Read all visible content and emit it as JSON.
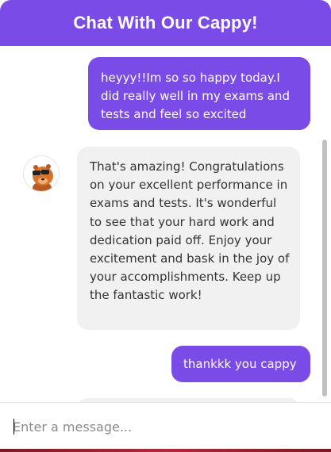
{
  "header": {
    "title": "Chat With Our Cappy!"
  },
  "messages": [
    {
      "sender": "user",
      "text": "heyyy!!Im so so happy today.I did really well in my exams and tests and feel so excited"
    },
    {
      "sender": "bot",
      "text": "That's amazing! Congratulations on your excellent performance in exams and tests. It's wonderful to see that your hard work and dedication paid off. Enjoy your excitement and bask in the joy of your accomplishments. Keep up the fantastic work!"
    },
    {
      "sender": "user",
      "text": "thankkk you cappy"
    }
  ],
  "bot": {
    "avatar_icon": "capybara-with-glasses-icon"
  },
  "input": {
    "placeholder": "Enter a message..."
  },
  "colors": {
    "accent": "#7a4be6",
    "bot_bubble": "#f1f1f1",
    "bot_text": "#333333"
  }
}
